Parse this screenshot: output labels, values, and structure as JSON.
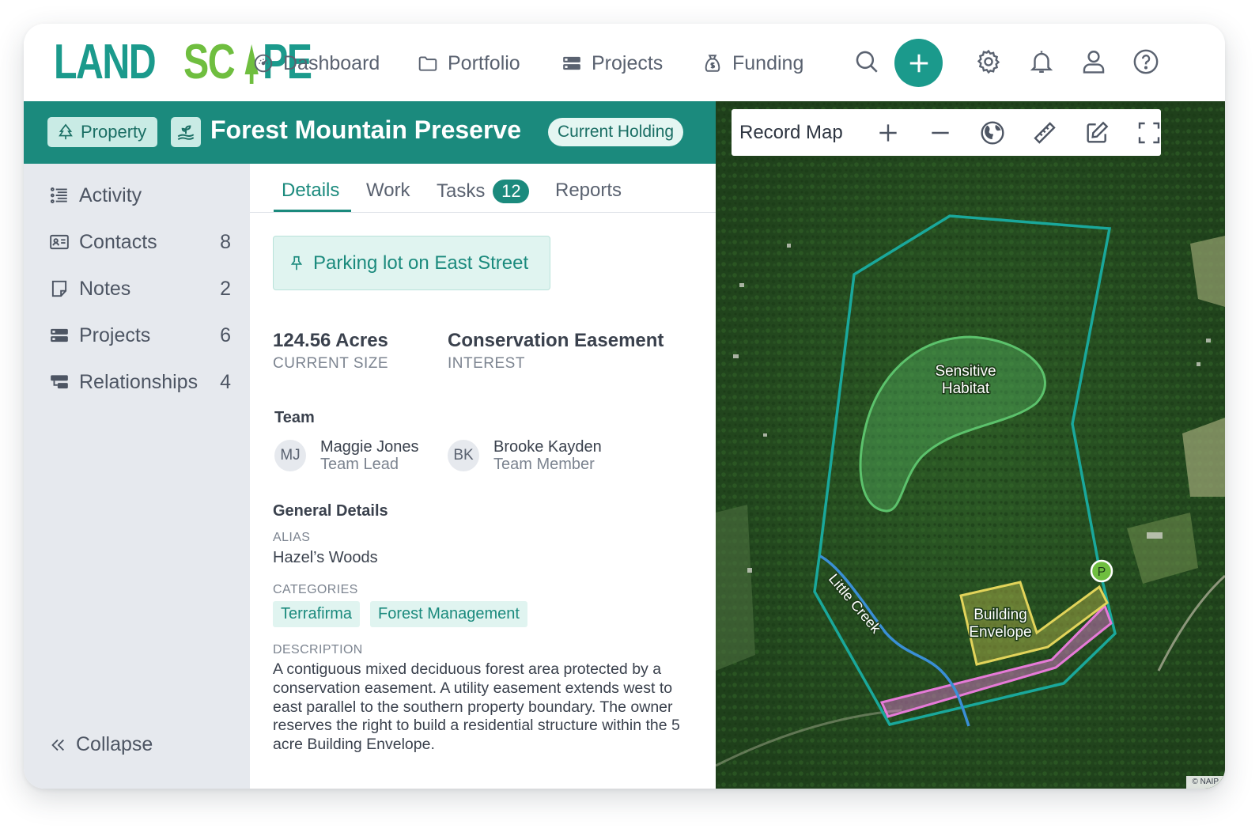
{
  "brand": {
    "logo_part1": "LAND",
    "logo_part2": "SC",
    "logo_part3": "PE",
    "colors": {
      "teal": "#1b9a8c",
      "green": "#6fbe3f"
    }
  },
  "nav": {
    "items": [
      {
        "label": "Dashboard",
        "icon": "gauge-icon"
      },
      {
        "label": "Portfolio",
        "icon": "folder-icon"
      },
      {
        "label": "Projects",
        "icon": "projects-icon"
      },
      {
        "label": "Funding",
        "icon": "money-bag-icon"
      }
    ],
    "actions": [
      "search-icon",
      "add-icon",
      "gear-icon",
      "bell-icon",
      "user-icon",
      "help-icon"
    ]
  },
  "property": {
    "type_label": "Property",
    "title": "Forest Mountain Preserve",
    "status": "Current Holding"
  },
  "sidebar": {
    "items": [
      {
        "label": "Activity",
        "count": "",
        "icon": "activity-icon"
      },
      {
        "label": "Contacts",
        "count": "8",
        "icon": "contact-card-icon"
      },
      {
        "label": "Notes",
        "count": "2",
        "icon": "note-icon"
      },
      {
        "label": "Projects",
        "count": "6",
        "icon": "projects-icon"
      },
      {
        "label": "Relationships",
        "count": "4",
        "icon": "relationships-icon"
      }
    ],
    "collapse_label": "Collapse"
  },
  "tabs": [
    {
      "label": "Details",
      "active": true
    },
    {
      "label": "Work"
    },
    {
      "label": "Tasks",
      "count": "12"
    },
    {
      "label": "Reports"
    }
  ],
  "details": {
    "parking_note": "Parking lot on East Street",
    "size_value": "124.56 Acres",
    "size_label": "CURRENT SIZE",
    "interest_value": "Conservation Easement",
    "interest_label": "INTEREST",
    "team_title": "Team",
    "team": [
      {
        "initials": "MJ",
        "name": "Maggie Jones",
        "role": "Team Lead"
      },
      {
        "initials": "BK",
        "name": "Brooke Kayden",
        "role": "Team Member"
      }
    ],
    "general_title": "General Details",
    "alias_label": "ALIAS",
    "alias_value": "Hazel’s Woods",
    "categories_label": "CATEGORIES",
    "categories": [
      "Terrafirma",
      "Forest Management"
    ],
    "description_label": "DESCRIPTION",
    "description": "A contiguous mixed deciduous forest area protected by a conservation easement. A utility easement extends west to east parallel to the southern property boundary. The owner reserves the right to build a residential structure within the 5 acre Building Envelope."
  },
  "map": {
    "title": "Record Map",
    "labels": {
      "habitat": "Sensitive Habitat",
      "creek": "Little Creek",
      "envelope": "Building Envelope",
      "parking_marker": "P"
    },
    "attribution": "© NAIP",
    "colors": {
      "boundary": "#1aa89b",
      "habitat": "#5cc26c",
      "creek": "#3a8fd6",
      "envelope": "#e2d45a",
      "utility": "#e67ad8"
    }
  }
}
